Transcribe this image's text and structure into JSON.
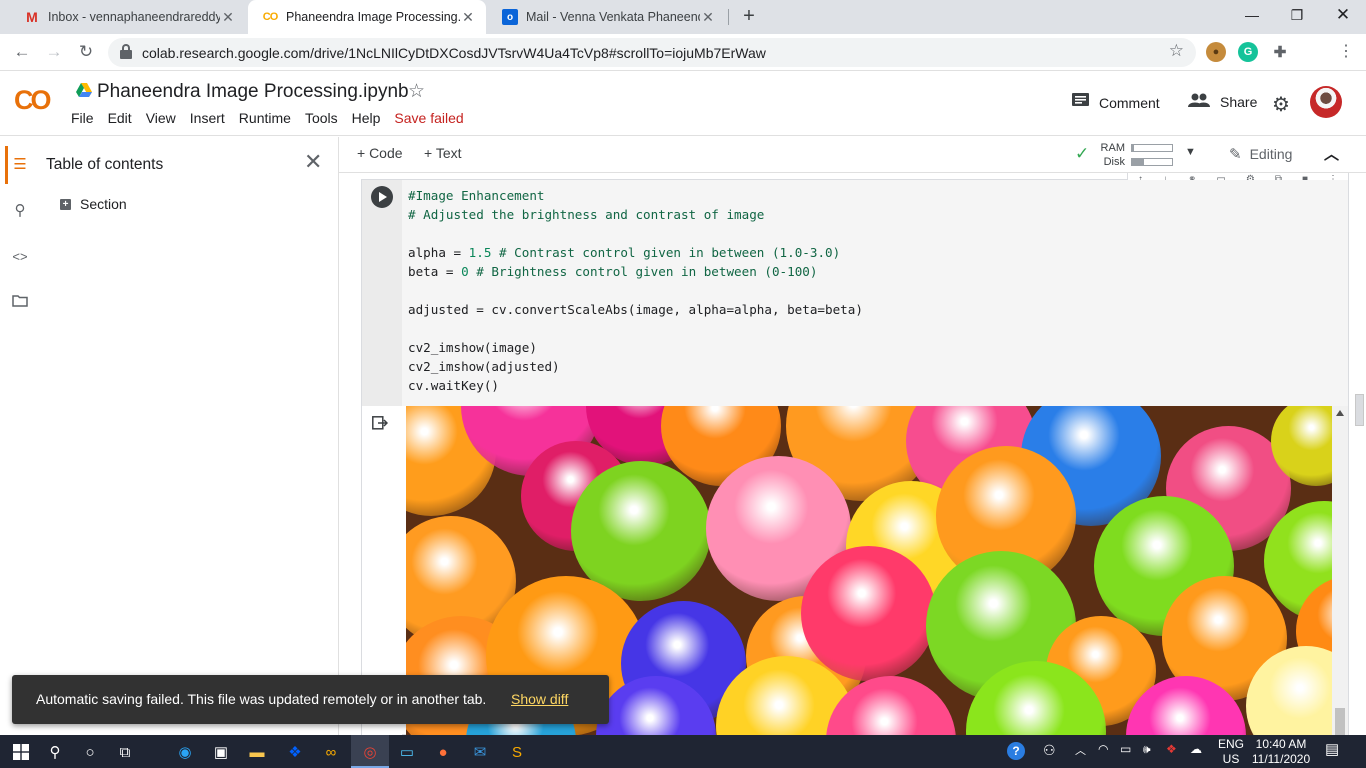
{
  "browser": {
    "tabs": [
      {
        "title": "Inbox - vennaphaneendrareddy@",
        "icon": "gmail-icon"
      },
      {
        "title": "Phaneendra Image Processing.ip",
        "icon": "colab-icon"
      },
      {
        "title": "Mail - Venna Venkata Phaneendr",
        "icon": "outlook-icon"
      }
    ],
    "url": "colab.research.google.com/drive/1NcLNIlCyDtDXCosdJVTsrvW4Ua4TcVp8#scrollTo=iojuMb7ErWaw"
  },
  "colab": {
    "logo": "CO",
    "notebook_title": "Phaneendra Image Processing.ipynb",
    "menu": [
      "File",
      "Edit",
      "View",
      "Insert",
      "Runtime",
      "Tools",
      "Help"
    ],
    "save_status": "Save failed",
    "comment_label": "Comment",
    "share_label": "Share"
  },
  "sidebar": {
    "title": "Table of contents",
    "items": [
      {
        "label": "Section"
      }
    ]
  },
  "toolbar": {
    "code_label": "+ Code",
    "text_label": "+ Text",
    "ram_label": "RAM",
    "disk_label": "Disk",
    "ram_usage": 0.05,
    "disk_usage": 0.3,
    "editing_label": "Editing"
  },
  "cell": {
    "lines": [
      "#Image Enhancement",
      "# Adjusted the brightness and contrast of image",
      "",
      "alpha = 1.5 # Contrast control given in between (1.0-3.0)",
      "beta = 0 # Brightness control given in between (0-100)",
      "",
      "adjusted = cv.convertScaleAbs(image, alpha=alpha, beta=beta)",
      "",
      "cv2_imshow(image)",
      "cv2_imshow(adjusted)",
      "cv.waitKey()"
    ]
  },
  "snackbar": {
    "message": "Automatic saving failed. This file was updated remotely or in another tab.",
    "action": "Show diff"
  },
  "taskbar": {
    "language": "ENG",
    "region": "US",
    "time": "10:40 AM",
    "date": "11/11/2020"
  },
  "colors": {
    "accent": "#e8710a",
    "error": "#c5221f",
    "link": "#fdd663"
  }
}
